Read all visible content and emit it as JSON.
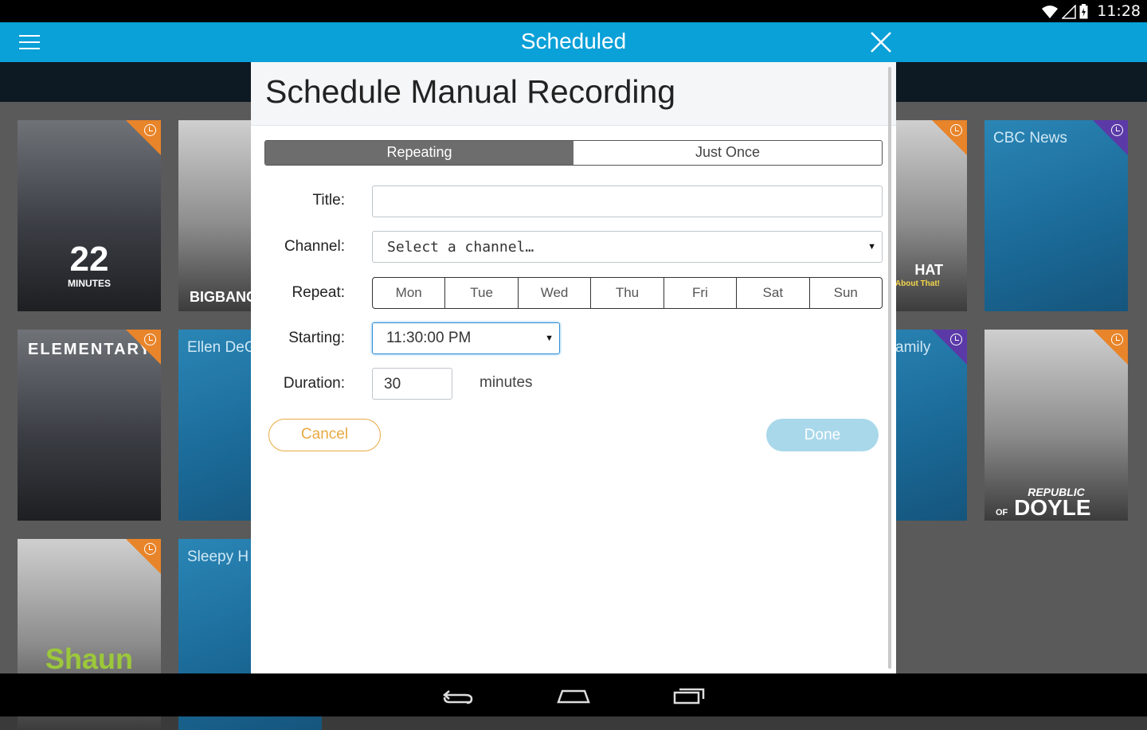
{
  "status": {
    "time": "11:28"
  },
  "appbar": {
    "title": "Scheduled"
  },
  "tiles": {
    "t22_badge": "22",
    "t22_sub": "MINUTES",
    "bigbang": "BIGBANG",
    "elementary": "ELEMENTARY",
    "ellen": "Ellen DeG",
    "shaun": "Shaun",
    "sleepy": "Sleepy H",
    "cat_hat": "HAT",
    "cat_sub": "About That!",
    "family": "amily",
    "cbc": "CBC News",
    "doyle_top": "REPUBLIC",
    "doyle_of": "OF",
    "doyle": "DOYLE"
  },
  "dialog": {
    "title": "Schedule Manual Recording",
    "tabs": [
      "Repeating",
      "Just Once"
    ],
    "labels": {
      "title": "Title:",
      "channel": "Channel:",
      "repeat": "Repeat:",
      "starting": "Starting:",
      "duration": "Duration:"
    },
    "title_value": "",
    "channel_value": "Select a channel…",
    "days": [
      "Mon",
      "Tue",
      "Wed",
      "Thu",
      "Fri",
      "Sat",
      "Sun"
    ],
    "starting_value": "11:30:00 PM",
    "duration_value": "30",
    "duration_unit": "minutes",
    "cancel": "Cancel",
    "done": "Done"
  },
  "colors": {
    "appbar": "#0aa0d8",
    "cancel": "#e8a942",
    "done": "#a9d8ea",
    "corner_orange": "#e8842a",
    "corner_purple": "#5b3aa8"
  }
}
